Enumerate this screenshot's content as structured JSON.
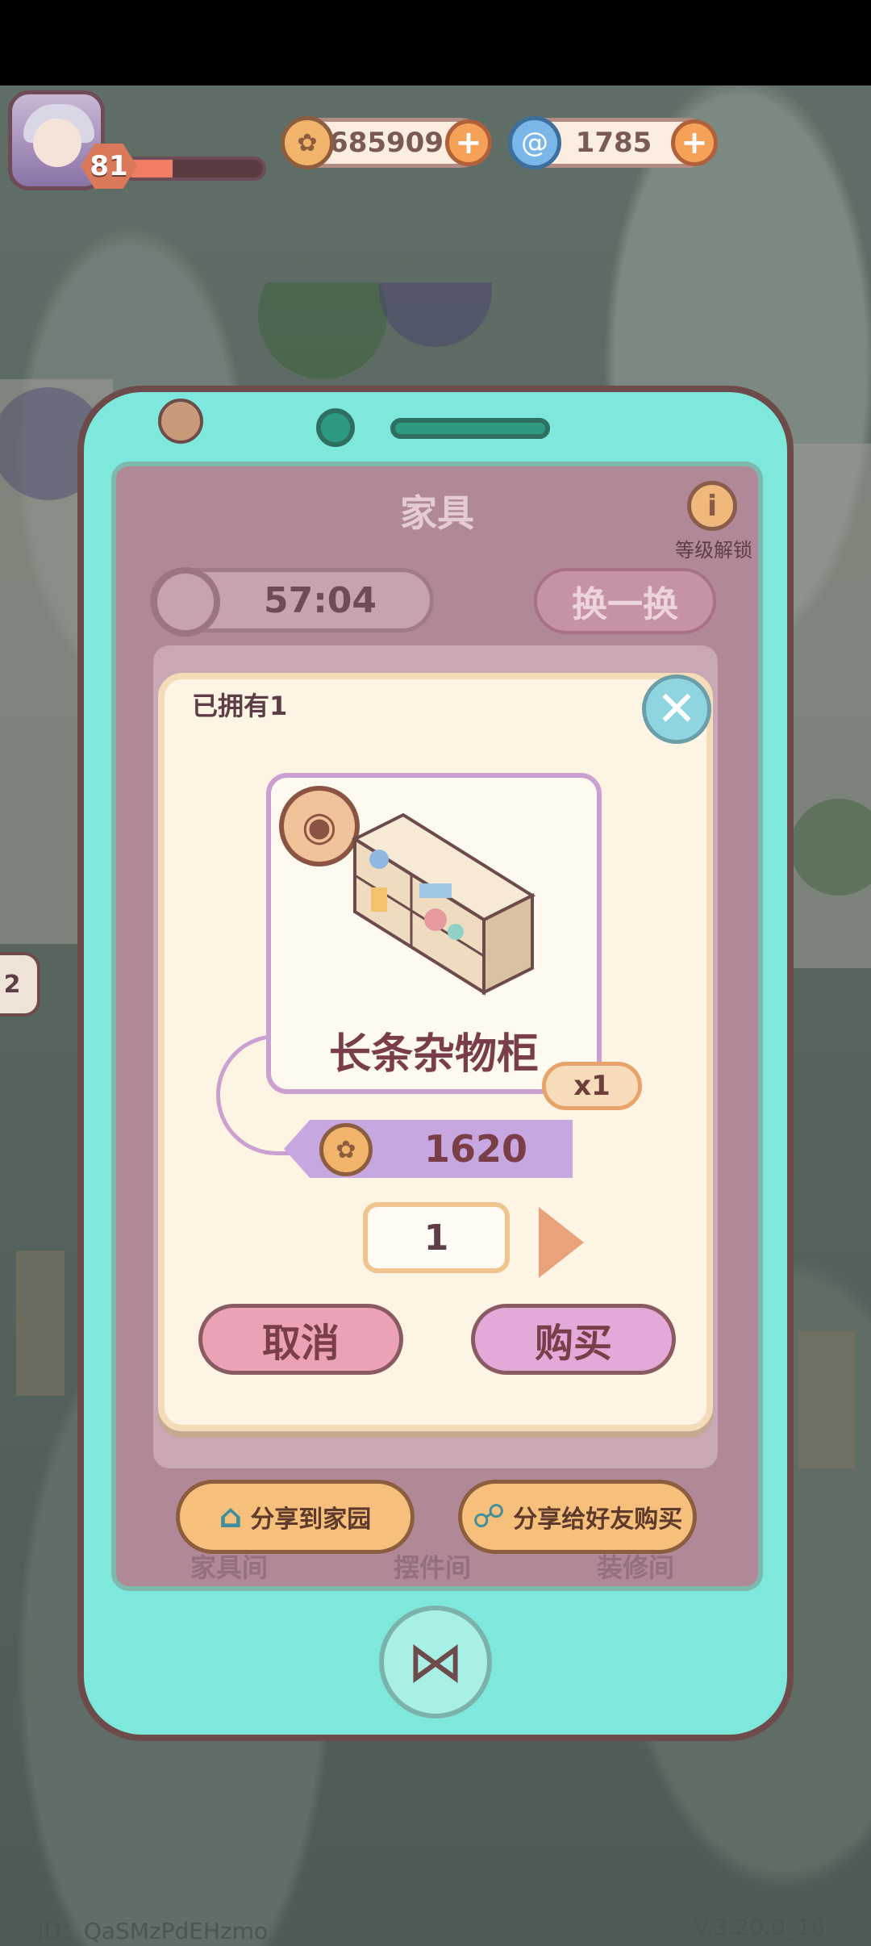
{
  "hud": {
    "level": "81",
    "xp_progress": 0.35,
    "coins": "685909",
    "gems": "1785"
  },
  "panel": {
    "title": "家具",
    "level_unlock_label": "等级解锁",
    "timer": "57:04",
    "swap_label": "换一换",
    "share_home_label": "分享到家园",
    "share_friend_label": "分享给好友购买",
    "tabs": [
      "家具间",
      "摆件间",
      "装修间"
    ]
  },
  "dialog": {
    "owned_text": "已拥有1",
    "item_name": "长条杂物柜",
    "stock_tag": "x1",
    "price": "1620",
    "quantity": "1",
    "cancel_label": "取消",
    "buy_label": "购买"
  },
  "side": {
    "badge": "2"
  },
  "footer": {
    "id_text": "ID：QaSMzPdEHzmo",
    "version": "V.3.20.0_16"
  },
  "colors": {
    "phone_body": "#7ee8dc",
    "panel_bg": "#b08898",
    "dialog_bg": "#fdf4e4",
    "price_tag": "#c7a7e0",
    "cancel_btn": "#eba2b4",
    "buy_btn": "#e3a9d8"
  }
}
